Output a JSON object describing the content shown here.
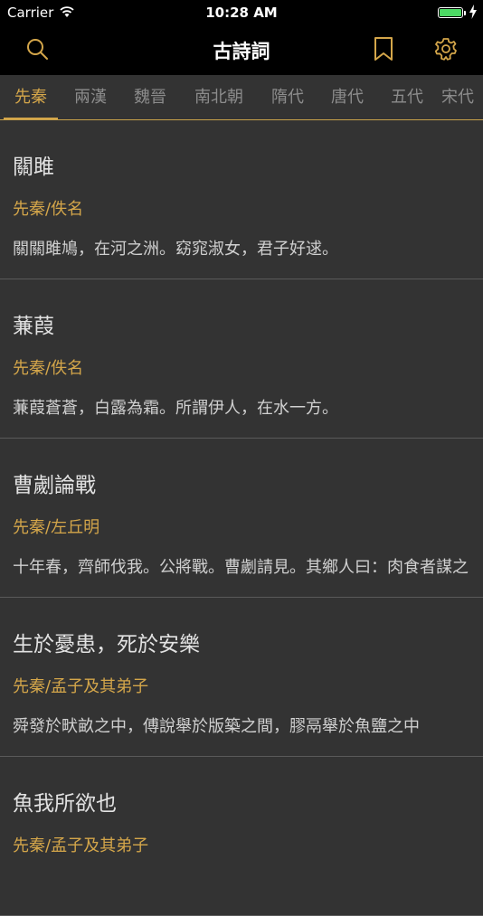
{
  "status": {
    "carrier": "Carrier",
    "time": "10:28 AM",
    "battery_level": 1.0
  },
  "navbar": {
    "title": "古詩詞",
    "icons": [
      "search-icon",
      "bookmark-icon",
      "settings-icon"
    ]
  },
  "tabs": [
    {
      "label": "先秦",
      "active": true
    },
    {
      "label": "兩漢",
      "active": false
    },
    {
      "label": "魏晉",
      "active": false
    },
    {
      "label": "南北朝",
      "active": false
    },
    {
      "label": "隋代",
      "active": false
    },
    {
      "label": "唐代",
      "active": false
    },
    {
      "label": "五代",
      "active": false
    },
    {
      "label": "宋代",
      "active": false
    }
  ],
  "poems": [
    {
      "title": "關雎",
      "author": "先秦/佚名",
      "excerpt": "關關雎鳩，在河之洲。窈窕淑女，君子好逑。"
    },
    {
      "title": "蒹葭",
      "author": "先秦/佚名",
      "excerpt": "蒹葭蒼蒼，白露為霜。所謂伊人，在水一方。"
    },
    {
      "title": "曹劌論戰",
      "author": "先秦/左丘明",
      "excerpt": "十年春，齊師伐我。公將戰。曹劌請見。其鄉人曰：肉食者謀之"
    },
    {
      "title": "生於憂患，死於安樂",
      "author": "先秦/孟子及其弟子",
      "excerpt": "舜發於畎畝之中，傅說舉於版築之間，膠鬲舉於魚鹽之中"
    },
    {
      "title": "魚我所欲也",
      "author": "先秦/孟子及其弟子",
      "excerpt": ""
    }
  ],
  "colors": {
    "accent": "#d4a64a",
    "background": "#333333",
    "bar": "#000000"
  }
}
